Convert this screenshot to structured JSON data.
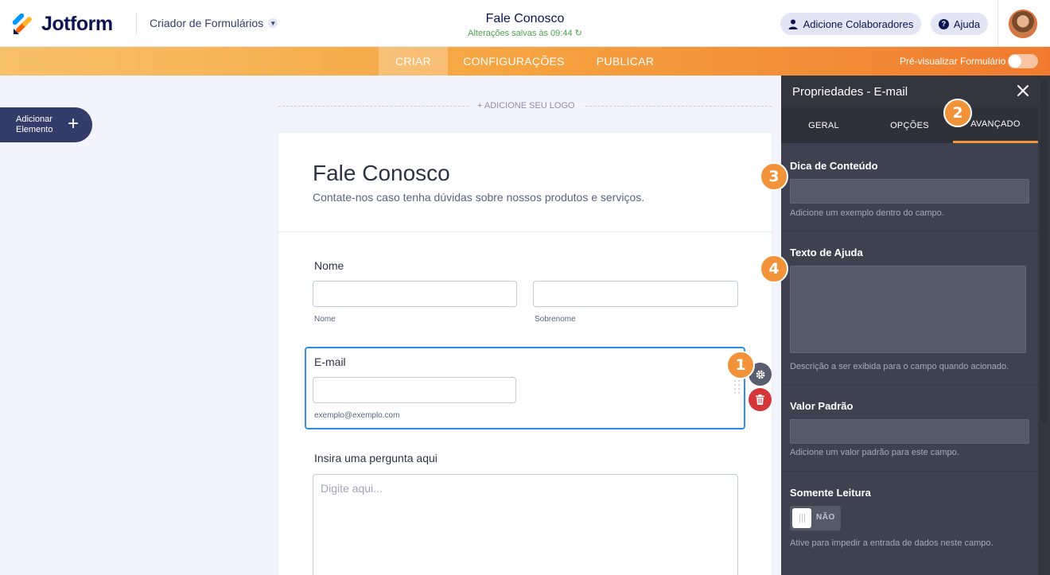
{
  "header": {
    "logo_text": "Jotform",
    "builder_menu": "Criador de Formulários",
    "form_title": "Fale Conosco",
    "saved_status": "Alterações salvas às 09:44",
    "collab_label": "Adicione Colaboradores",
    "help_label": "Ajuda",
    "icons": [
      "jotform-logo-icon",
      "chevron-down-icon",
      "refresh-icon",
      "user-icon",
      "question-icon",
      "avatar"
    ]
  },
  "nav": {
    "tabs": [
      {
        "label": "CRIAR",
        "active": true
      },
      {
        "label": "CONFIGURAÇÕES",
        "active": false
      },
      {
        "label": "PUBLICAR",
        "active": false
      }
    ],
    "preview_label": "Pré-visualizar Formulário",
    "preview_enabled": false
  },
  "add_element": {
    "label": "Adicionar Elemento",
    "icon": "plus-icon"
  },
  "form": {
    "logo_placeholder": "+ ADICIONE SEU LOGO",
    "heading": "Fale Conosco",
    "subheading": "Contate-nos caso tenha dúvidas sobre nossos produtos e serviços.",
    "name_field": {
      "label": "Nome",
      "first_sublabel": "Nome",
      "last_sublabel": "Sobrenome"
    },
    "email_field": {
      "label": "E-mail",
      "sublabel": "exemplo@exemplo.com"
    },
    "question_field": {
      "label": "Insira uma pergunta aqui",
      "placeholder": "Digite aqui..."
    }
  },
  "badges": [
    "1",
    "2",
    "3",
    "4"
  ],
  "panel": {
    "title": "Propriedades - E-mail",
    "tabs": [
      {
        "label": "GERAL",
        "active": false
      },
      {
        "label": "OPÇÕES",
        "active": false
      },
      {
        "label": "AVANÇADO",
        "active": true
      }
    ],
    "sections": {
      "hint": {
        "label": "Dica de Conteúdo",
        "help": "Adicione um exemplo dentro do campo."
      },
      "help_text": {
        "label": "Texto de Ajuda",
        "help": "Descrição a ser exibida para o campo quando acionado."
      },
      "default": {
        "label": "Valor Padrão",
        "help": "Adicione um valor padrão para este campo."
      },
      "readonly": {
        "label": "Somente Leitura",
        "toggle_label": "NÃO",
        "help": "Ative para impedir a entrada de dados neste campo."
      }
    }
  },
  "colors": {
    "accent": "#f2933a",
    "focus": "#2f8fe2",
    "danger": "#d5363a",
    "panel_bg": "#3e4250",
    "saved": "#47a44b"
  }
}
